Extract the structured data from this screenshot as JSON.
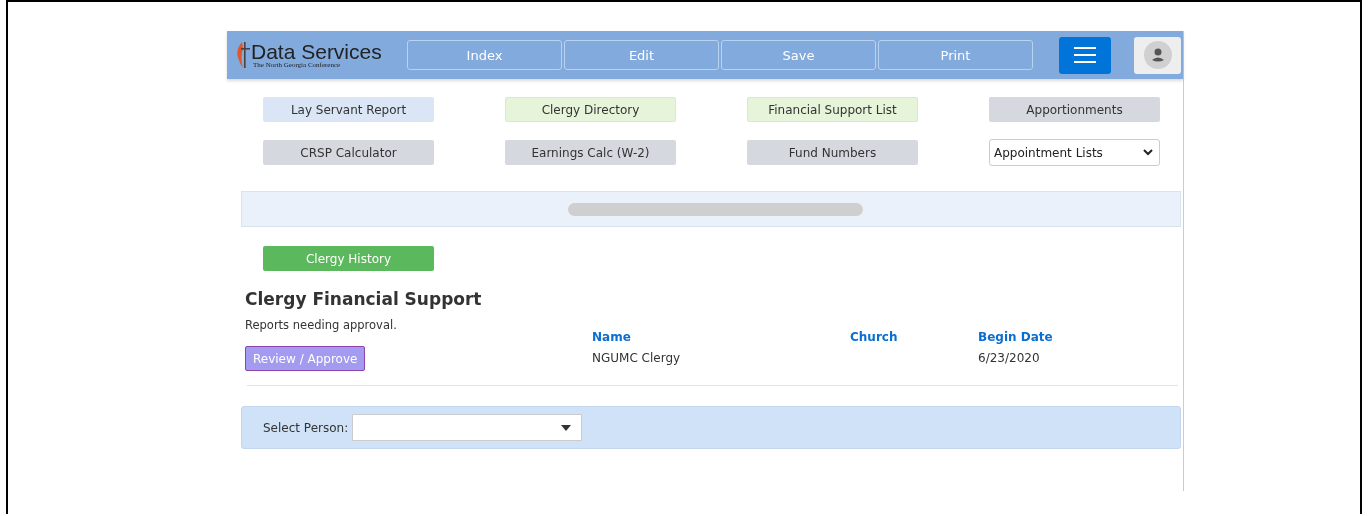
{
  "header": {
    "logo_title": "Data Services",
    "logo_subtitle": "The North Georgia Conference",
    "nav_buttons": [
      {
        "label": "Index",
        "disabled": true
      },
      {
        "label": "Edit",
        "disabled": true
      },
      {
        "label": "Save",
        "disabled": true
      },
      {
        "label": "Print",
        "disabled": true
      }
    ]
  },
  "quick_links": [
    {
      "label": "Lay Servant Report",
      "kind": "info"
    },
    {
      "label": "Clergy Directory",
      "kind": "success"
    },
    {
      "label": "Financial Support List",
      "kind": "success"
    },
    {
      "label": "Apportionments",
      "kind": "secondary"
    },
    {
      "label": "CRSP Calculator",
      "kind": "secondary"
    },
    {
      "label": "Earnings Calc (W-2)",
      "kind": "secondary"
    },
    {
      "label": "Fund Numbers",
      "kind": "secondary"
    },
    {
      "label": "Appointment Lists",
      "kind": "dropdown"
    }
  ],
  "clergy_history_button": "Clergy History",
  "section": {
    "title": "Clergy Financial Support",
    "subtitle": "Reports needing approval.",
    "action_button": "Review / Approve",
    "columns": [
      "Name",
      "Church",
      "Begin Date"
    ],
    "rows": [
      [
        "NGUMC Clergy",
        "",
        "6/23/2020"
      ]
    ]
  },
  "select_person": {
    "label": "Select Person:"
  }
}
